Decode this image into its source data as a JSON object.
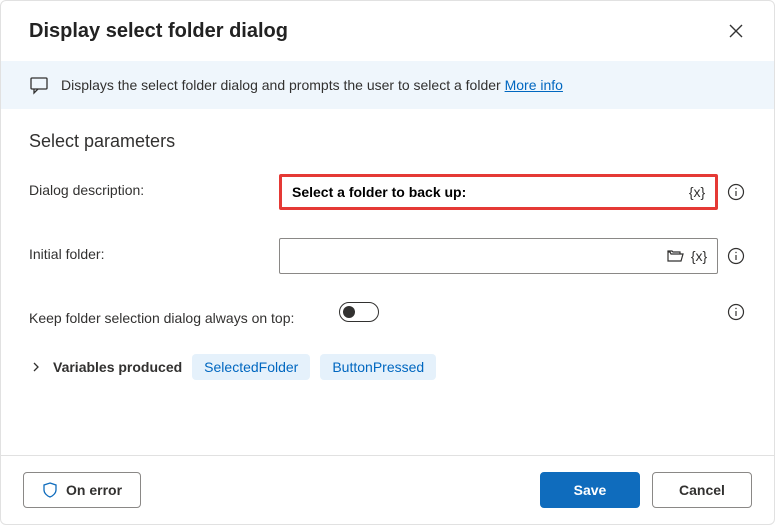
{
  "header": {
    "title": "Display select folder dialog"
  },
  "banner": {
    "text": "Displays the select folder dialog and prompts the user to select a folder",
    "link": "More info"
  },
  "section": {
    "title": "Select parameters"
  },
  "fields": {
    "description": {
      "label": "Dialog description:",
      "value": "Select a folder to back up:"
    },
    "initialFolder": {
      "label": "Initial folder:",
      "value": ""
    },
    "keepOnTop": {
      "label": "Keep folder selection dialog always on top:",
      "value": false
    }
  },
  "variables": {
    "label": "Variables produced",
    "items": [
      "SelectedFolder",
      "ButtonPressed"
    ]
  },
  "footer": {
    "onError": "On error",
    "save": "Save",
    "cancel": "Cancel"
  },
  "icons": {
    "varToken": "{x}"
  }
}
